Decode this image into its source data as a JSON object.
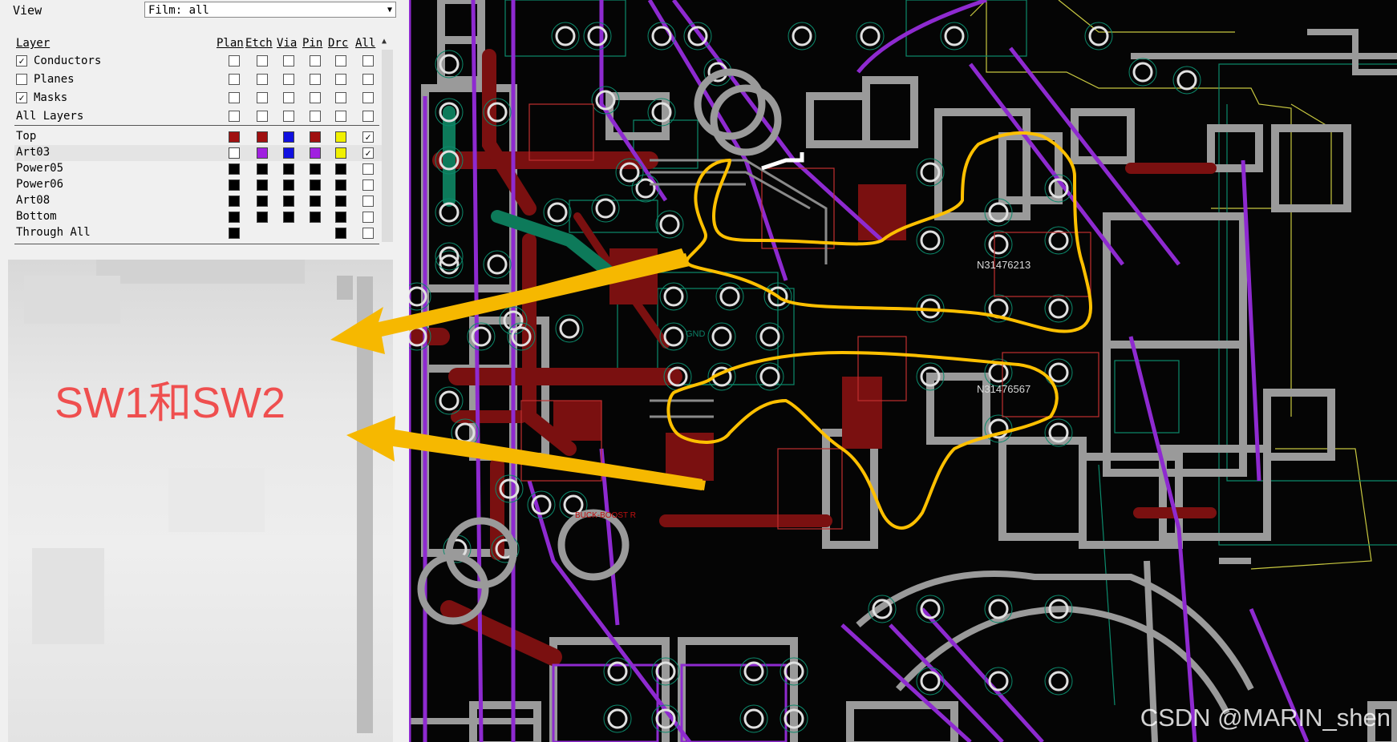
{
  "panel": {
    "view_label": "View",
    "view_value": "Film: all",
    "columns": [
      "Layer",
      "Plan",
      "Etch",
      "Via",
      "Pin",
      "Drc",
      "All"
    ],
    "groups": [
      {
        "label": "Conductors",
        "checked": true
      },
      {
        "label": "Planes",
        "checked": false
      },
      {
        "label": "Masks",
        "checked": true
      },
      {
        "label": "All Layers",
        "checked": null
      }
    ],
    "layers": [
      {
        "label": "Top",
        "colors": [
          "#a01010",
          "#a01010",
          "#1010e0",
          "#a01010",
          "#f0f000"
        ],
        "all": true
      },
      {
        "label": "Art03",
        "colors": [
          null,
          "#a020e0",
          "#1010e0",
          "#a020e0",
          "#f0f000"
        ],
        "all": true
      },
      {
        "label": "Power05",
        "colors": [
          "#000",
          "#000",
          "#000",
          "#000",
          "#000"
        ],
        "all": false
      },
      {
        "label": "Power06",
        "colors": [
          "#000",
          "#000",
          "#000",
          "#000",
          "#000"
        ],
        "all": false
      },
      {
        "label": "Art08",
        "colors": [
          "#000",
          "#000",
          "#000",
          "#000",
          "#000"
        ],
        "all": false
      },
      {
        "label": "Bottom",
        "colors": [
          "#000",
          "#000",
          "#000",
          "#000",
          "#000"
        ],
        "all": false
      },
      {
        "label": "Through All",
        "colors": [
          "#000",
          null,
          null,
          null,
          "#000"
        ],
        "all": false
      }
    ]
  },
  "annotation": {
    "text": "SW1和SW2",
    "text_color": "#ef4f4f",
    "arrow_color": "#f6b800",
    "outline_color": "#ffc000"
  },
  "pcb": {
    "components": [
      "N31476213",
      "N31476567"
    ],
    "net_label": "GND",
    "silk_labels": [
      "BUCK-BOOST R"
    ]
  },
  "watermark": "CSDN @MARIN_shen",
  "colors": {
    "pad_gray": "#9a9a9a",
    "top_copper": "#7a1010",
    "art03_trace": "#8e2ad0",
    "via_blue": "#1020c0",
    "teal_outline": "#0c8a6c",
    "board_outline": "#c8c840"
  }
}
